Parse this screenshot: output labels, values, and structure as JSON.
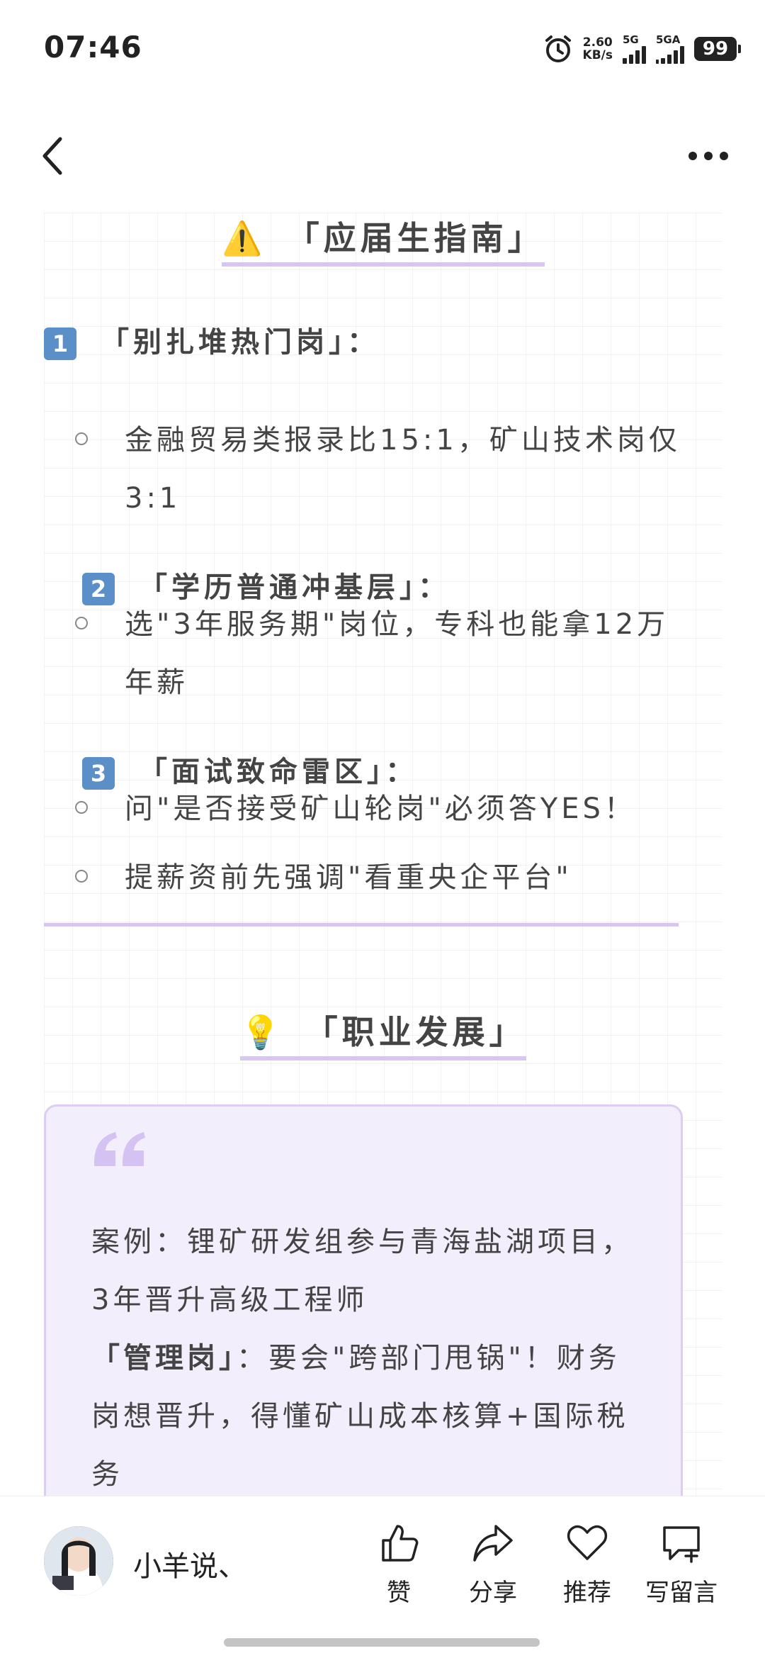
{
  "status_bar": {
    "time": "07:46",
    "net_speed_value": "2.60",
    "net_speed_unit": "KB/s",
    "signal1_label": "5G",
    "signal2_label": "5GA",
    "battery": "99"
  },
  "article": {
    "section1": {
      "emoji": "⚠️",
      "title": "「应届生指南」",
      "items": [
        {
          "num": "1",
          "heading": "「别扎堆热门岗」：",
          "bullets": [
            "金融贸易类报录比15:1，矿山技术岗仅3:1"
          ]
        },
        {
          "num": "2",
          "heading": "「学历普通冲基层」：",
          "bullets": [
            "选\"3年服务期\"岗位，专科也能拿12万年薪"
          ]
        },
        {
          "num": "3",
          "heading": "「面试致命雷区」：",
          "bullets": [
            "问\"是否接受矿山轮岗\"必须答YES！",
            "提薪资前先强调\"看重央企平台\""
          ]
        }
      ]
    },
    "section2": {
      "emoji": "💡",
      "title": "「职业发展」",
      "quote": {
        "line1": "案例：锂矿研发组参与青海盐湖项目，3年晋升高级工程师",
        "line2_bold": "「管理岗」",
        "line2_rest": "：要会\"跨部门甩锅\"！财务岗想晋升，得懂矿山成本核算+国际税务"
      }
    }
  },
  "bottom_bar": {
    "author": "小羊说、",
    "actions": [
      {
        "label": "赞",
        "icon": "thumbs-up-icon"
      },
      {
        "label": "分享",
        "icon": "share-icon"
      },
      {
        "label": "推荐",
        "icon": "heart-icon"
      },
      {
        "label": "写留言",
        "icon": "comment-add-icon"
      }
    ]
  },
  "colors": {
    "accent_underline": "#d7c7f0",
    "quote_bg": "#f3eefc",
    "number_badge": "#5b8fc8"
  }
}
